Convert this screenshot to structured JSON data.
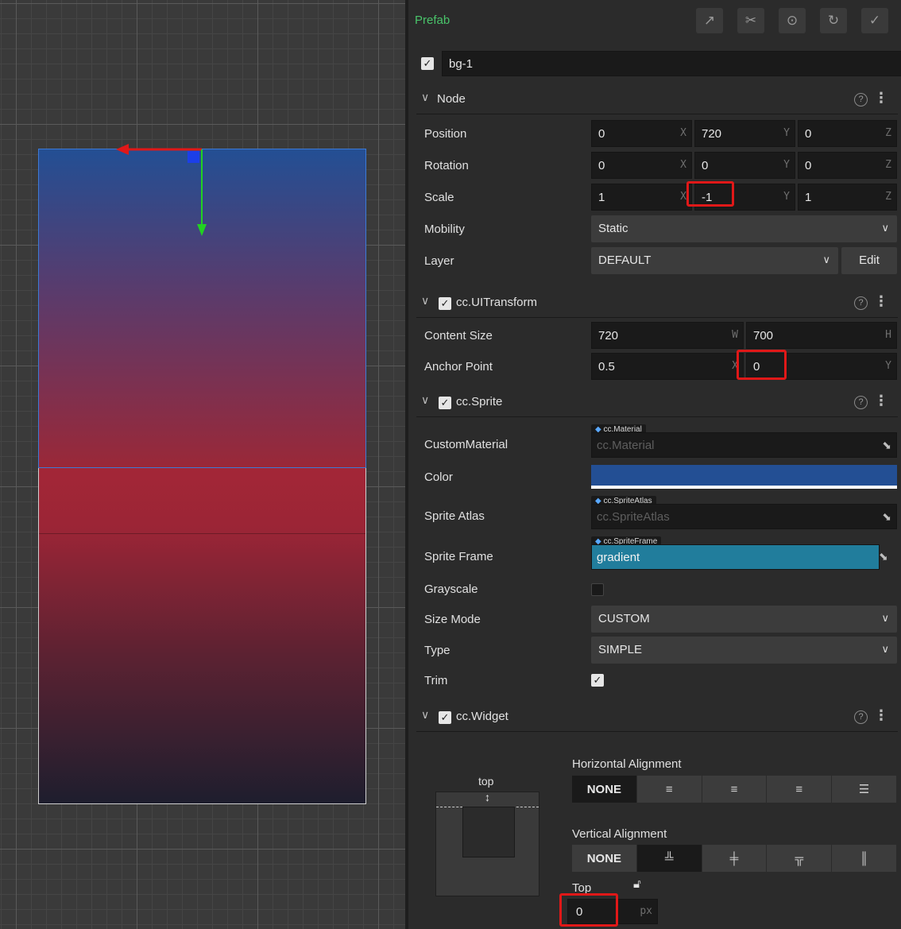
{
  "prefab": {
    "label": "Prefab"
  },
  "node_name": "bg-1",
  "node": {
    "title": "Node",
    "position": {
      "label": "Position",
      "x": "0",
      "y": "720",
      "z": "0"
    },
    "rotation": {
      "label": "Rotation",
      "x": "0",
      "y": "0",
      "z": "0"
    },
    "scale": {
      "label": "Scale",
      "x": "1",
      "y": "-1",
      "z": "1"
    },
    "mobility": {
      "label": "Mobility",
      "value": "Static"
    },
    "layer": {
      "label": "Layer",
      "value": "DEFAULT",
      "edit_label": "Edit"
    },
    "axis": {
      "x": "X",
      "y": "Y",
      "z": "Z",
      "w": "W",
      "h": "H"
    }
  },
  "ui_transform": {
    "title": "cc.UITransform",
    "content_size": {
      "label": "Content Size",
      "w": "720",
      "h": "700"
    },
    "anchor_point": {
      "label": "Anchor Point",
      "x": "0.5",
      "y": "0"
    }
  },
  "sprite": {
    "title": "cc.Sprite",
    "custom_material": {
      "label": "CustomMaterial",
      "tag": "cc.Material",
      "placeholder": "cc.Material"
    },
    "color": {
      "label": "Color",
      "value": "#234f94"
    },
    "sprite_atlas": {
      "label": "Sprite Atlas",
      "tag": "cc.SpriteAtlas",
      "placeholder": "cc.SpriteAtlas"
    },
    "sprite_frame": {
      "label": "Sprite Frame",
      "tag": "cc.SpriteFrame",
      "value": "gradient"
    },
    "grayscale": {
      "label": "Grayscale"
    },
    "size_mode": {
      "label": "Size Mode",
      "value": "CUSTOM"
    },
    "type": {
      "label": "Type",
      "value": "SIMPLE"
    },
    "trim": {
      "label": "Trim"
    }
  },
  "widget": {
    "title": "cc.Widget",
    "preview_label": "top",
    "horizontal_label": "Horizontal Alignment",
    "vertical_label": "Vertical Alignment",
    "none_label": "NONE",
    "top": {
      "label": "Top",
      "value": "0",
      "unit": "px"
    }
  },
  "colors": {
    "accent_green": "#49c46a",
    "highlight": "#e01818",
    "sprite_frame_bg": "#217d9c"
  }
}
